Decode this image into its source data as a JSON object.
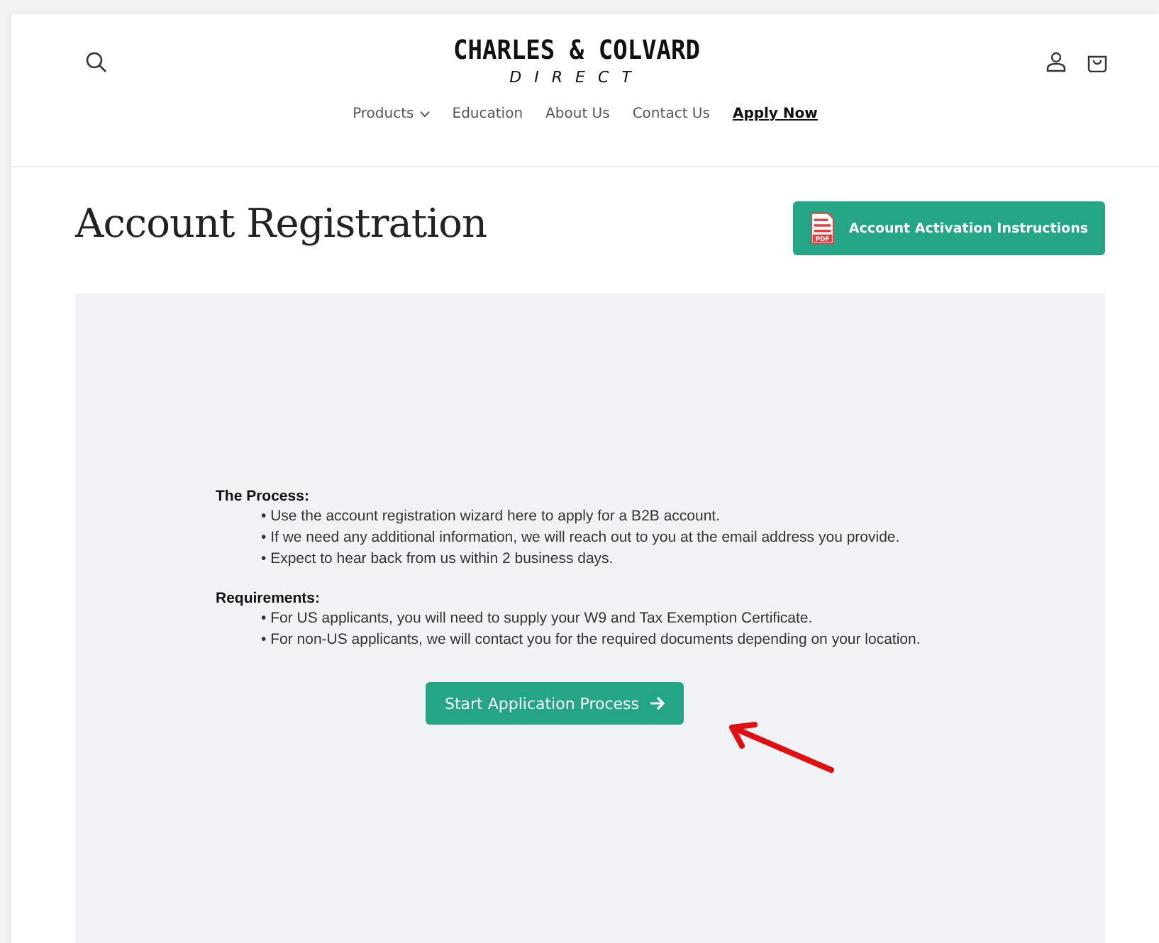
{
  "header": {
    "logo": {
      "name": "CHARLES & COLVARD",
      "sub": "DIRECT"
    },
    "nav": [
      {
        "label": "Products",
        "has_dropdown": true,
        "selected": false
      },
      {
        "label": "Education",
        "has_dropdown": false,
        "selected": false
      },
      {
        "label": "About Us",
        "has_dropdown": false,
        "selected": false
      },
      {
        "label": "Contact Us",
        "has_dropdown": false,
        "selected": false
      },
      {
        "label": "Apply Now",
        "has_dropdown": false,
        "selected": true
      }
    ]
  },
  "page_title": "Account Registration",
  "instructions_button": {
    "label": "Account Activation Instructions",
    "icon_label": "PDF"
  },
  "panel": {
    "sections": [
      {
        "heading": "The Process:",
        "items": [
          "• Use the account registration wizard here to apply for a B2B account.",
          "• If we need any additional information, we will reach out to you at the email address you provide.",
          "• Expect to hear back from us within 2 business days."
        ]
      },
      {
        "heading": "Requirements:",
        "items": [
          "• For US applicants, you will need to supply your W9 and Tax Exemption Certificate.",
          "• For non-US applicants, we will contact you for the required documents depending on your location."
        ]
      }
    ],
    "start_button": {
      "label": "Start Application Process"
    }
  }
}
